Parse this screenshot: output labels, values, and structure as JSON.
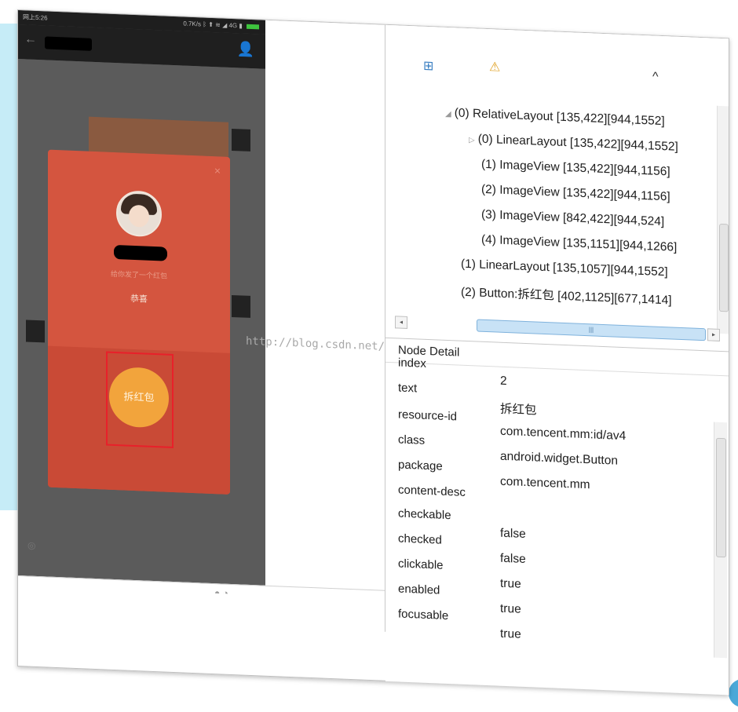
{
  "phone": {
    "status_left": "网上5:26",
    "status_right": "0.7K/s ᛒ ⬆ ≋ ◢ 4G ▮",
    "battery_label": "100%",
    "back_glyph": "←",
    "person_glyph": "👤",
    "bottom_left_glyph": "◎",
    "bottom_icons": "◓   ◔"
  },
  "hongbao": {
    "close_glyph": "×",
    "sender_sub": "给你发了一个红包",
    "message": "恭喜",
    "open_label": "拆红包"
  },
  "watermark": "http://blog.csdn.net/",
  "toolbar": {
    "expand_glyph": "⊞",
    "warning_glyph": "⚠",
    "caret_glyph": "^"
  },
  "tree": {
    "arrow_open": "◢",
    "arrow_closed": "▷",
    "nodes": [
      "(0) RelativeLayout [135,422][944,1552]",
      "(0) LinearLayout [135,422][944,1552]",
      "(1) ImageView [135,422][944,1156]",
      "(2) ImageView [135,422][944,1156]",
      "(3) ImageView [842,422][944,524]",
      "(4) ImageView [135,1151][944,1266]",
      "(1) LinearLayout [135,1057][944,1552]",
      "(2) Button:拆红包 [402,1125][677,1414]"
    ],
    "scroll_left": "◂",
    "scroll_mid": "|||",
    "scroll_right": "▸"
  },
  "detail": {
    "title": "Node Detail",
    "props": [
      {
        "name": "index",
        "value": "2"
      },
      {
        "name": "text",
        "value": "拆红包"
      },
      {
        "name": "resource-id",
        "value": "com.tencent.mm:id/av4"
      },
      {
        "name": "class",
        "value": "android.widget.Button"
      },
      {
        "name": "package",
        "value": "com.tencent.mm"
      },
      {
        "name": "content-desc",
        "value": ""
      },
      {
        "name": "checkable",
        "value": "false"
      },
      {
        "name": "checked",
        "value": "false"
      },
      {
        "name": "clickable",
        "value": "true"
      },
      {
        "name": "enabled",
        "value": "true"
      },
      {
        "name": "focusable",
        "value": "true"
      }
    ]
  },
  "colors": {
    "hongbao_red": "#d4553f",
    "open_button_orange": "#f2a43c",
    "highlight_red": "#e8202a",
    "deco_blue": "#c6ecf7"
  }
}
